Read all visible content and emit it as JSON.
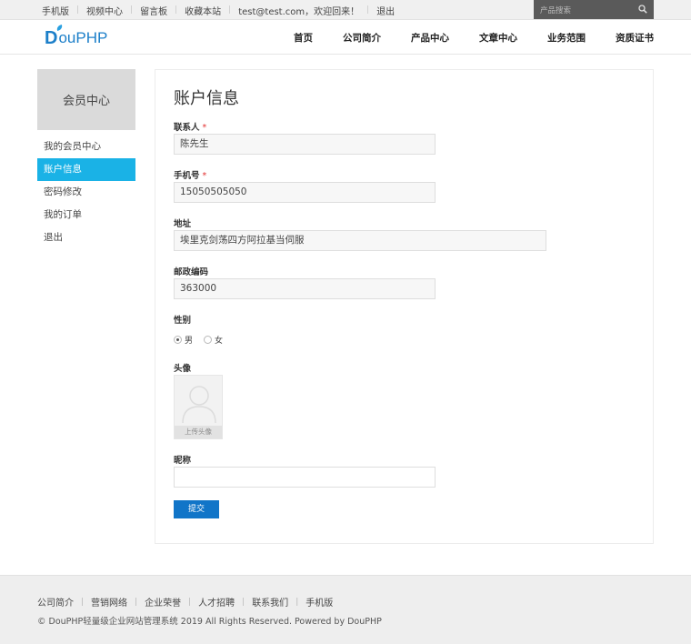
{
  "topbar": {
    "links": [
      "手机版",
      "视频中心",
      "留言板",
      "收藏本站",
      "test@test.com，欢迎回来！",
      "退出"
    ],
    "search_placeholder": "产品搜索"
  },
  "header": {
    "logo_first": "D",
    "logo_rest": "ouPHP",
    "nav": [
      "首页",
      "公司简介",
      "产品中心",
      "文章中心",
      "业务范围",
      "资质证书"
    ]
  },
  "sidebar": {
    "title": "会员中心",
    "items": [
      {
        "label": "我的会员中心",
        "active": false
      },
      {
        "label": "账户信息",
        "active": true
      },
      {
        "label": "密码修改",
        "active": false
      },
      {
        "label": "我的订单",
        "active": false
      },
      {
        "label": "退出",
        "active": false
      }
    ]
  },
  "main": {
    "heading": "账户信息",
    "contact_label": "联系人",
    "contact_value": "陈先生",
    "phone_label": "手机号",
    "phone_value": "15050505050",
    "address_label": "地址",
    "address_value": "埃里克剑荡四方阿拉基当伺服",
    "postcode_label": "邮政编码",
    "postcode_value": "363000",
    "gender_label": "性别",
    "gender_options": [
      "男",
      "女"
    ],
    "gender_selected": "男",
    "avatar_label": "头像",
    "avatar_upload": "上传头像",
    "nickname_label": "昵称",
    "nickname_value": "",
    "required_mark": "*",
    "submit_label": "提交"
  },
  "footer": {
    "links": [
      "公司简介",
      "营销网络",
      "企业荣誉",
      "人才招聘",
      "联系我们",
      "手机版"
    ],
    "copyright": "© DouPHP轻量级企业网站管理系统 2019 All Rights Reserved. Powered by DouPHP"
  },
  "colors": {
    "accent": "#1ab2e6",
    "submit": "#1175c8",
    "logo": "#1c7fc9",
    "required": "#e23030"
  }
}
